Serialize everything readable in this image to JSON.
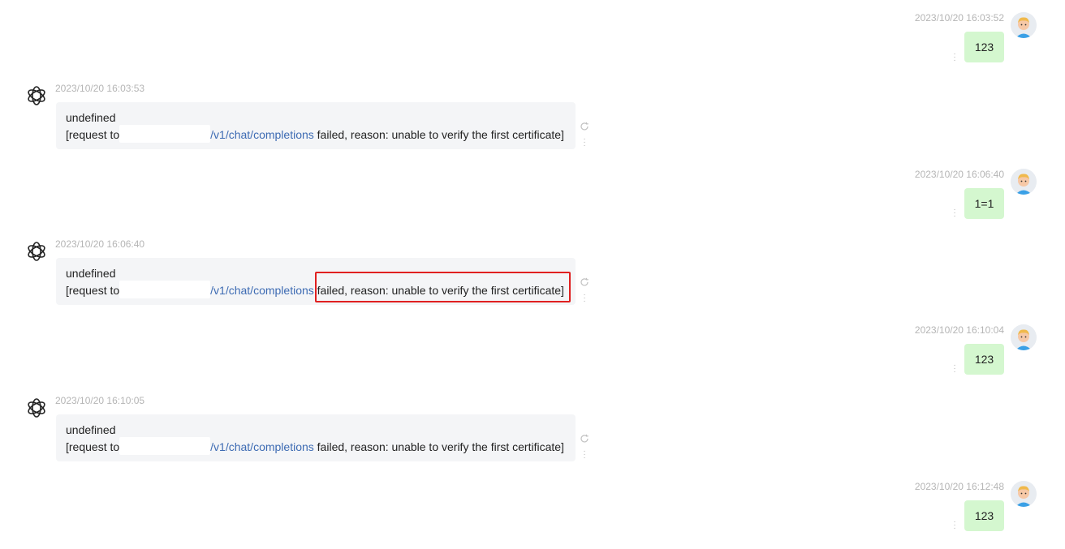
{
  "user_messages": [
    {
      "time": "2023/10/20 16:03:52",
      "text": "123"
    },
    {
      "time": "2023/10/20 16:06:40",
      "text": "1=1"
    },
    {
      "time": "2023/10/20 16:10:04",
      "text": "123"
    },
    {
      "time": "2023/10/20 16:12:48",
      "text": "123"
    }
  ],
  "bot_messages": [
    {
      "time": "2023/10/20 16:03:53",
      "line1": "undefined",
      "prefix": "[request to",
      "url": "/v1/chat/completions",
      "suffix": " failed, reason: unable to verify the first certificate]"
    },
    {
      "time": "2023/10/20 16:06:40",
      "line1": "undefined",
      "prefix": "[request to",
      "url": "/v1/chat/completions",
      "suffix": " failed, reason: unable to verify the first certificate]"
    },
    {
      "time": "2023/10/20 16:10:05",
      "line1": "undefined",
      "prefix": "[request to",
      "url": "/v1/chat/completions",
      "suffix": " failed, reason: unable to verify the first certificate]"
    }
  ],
  "icons": {
    "bot": "openai-logo-icon",
    "user": "user-avatar-icon",
    "more": "more-vertical-icon",
    "regenerate": "refresh-icon"
  },
  "colors": {
    "user_bubble": "#d4f7cf",
    "bot_bubble": "#f4f5f7",
    "link": "#3d6bb3",
    "highlight": "#e02020"
  }
}
